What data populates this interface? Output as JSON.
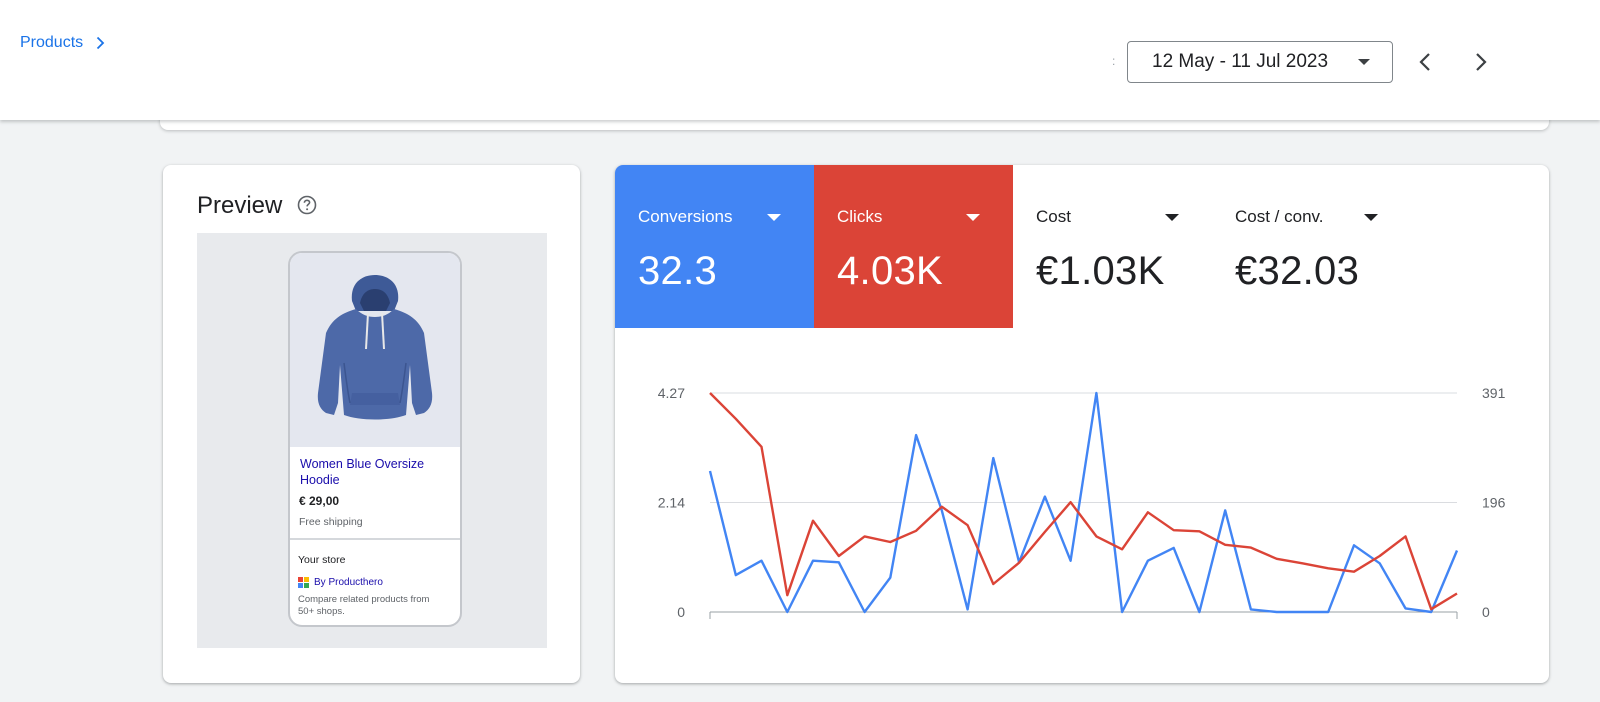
{
  "header": {
    "breadcrumb": "Products",
    "date_range": "12 May - 11 Jul 2023",
    "colon": ":"
  },
  "preview": {
    "title": "Preview",
    "product": {
      "name": "Women Blue Oversize Hoodie",
      "price": "€ 29,00",
      "shipping": "Free shipping",
      "store_label": "Your store",
      "by_line": "By Producthero",
      "compare_text": "Compare related products from 50+ shops."
    }
  },
  "metrics": [
    {
      "label": "Conversions",
      "value": "32.3",
      "color": "#4285f4"
    },
    {
      "label": "Clicks",
      "value": "4.03K",
      "color": "#db4437"
    },
    {
      "label": "Cost",
      "value": "€1.03K"
    },
    {
      "label": "Cost / conv.",
      "value": "€32.03"
    }
  ],
  "chart_data": {
    "type": "line",
    "left_axis": {
      "ticks": [
        "4.27",
        "2.14",
        "0"
      ],
      "ylim": [
        0,
        4.27
      ]
    },
    "right_axis": {
      "ticks": [
        "391",
        "196",
        "0"
      ],
      "ylim": [
        0,
        391
      ]
    },
    "series": [
      {
        "name": "Conversions",
        "axis": "left",
        "color": "#4285f4",
        "values": [
          2.75,
          0.72,
          1.0,
          0.0,
          1.0,
          0.97,
          0.0,
          0.67,
          3.45,
          1.98,
          0.05,
          3.0,
          0.97,
          2.25,
          1.0,
          4.27,
          0.0,
          1.0,
          1.25,
          0.0,
          1.98,
          0.05,
          0.0,
          0.0,
          0.0,
          1.3,
          0.95,
          0.07,
          0.0,
          1.2
        ]
      },
      {
        "name": "Clicks",
        "axis": "right",
        "color": "#db4437",
        "values": [
          391,
          345,
          295,
          30,
          163,
          100,
          135,
          125,
          145,
          188,
          155,
          50,
          88,
          143,
          196,
          135,
          112,
          178,
          146,
          144,
          120,
          115,
          95,
          87,
          78,
          72,
          100,
          135,
          5,
          33
        ]
      }
    ]
  }
}
